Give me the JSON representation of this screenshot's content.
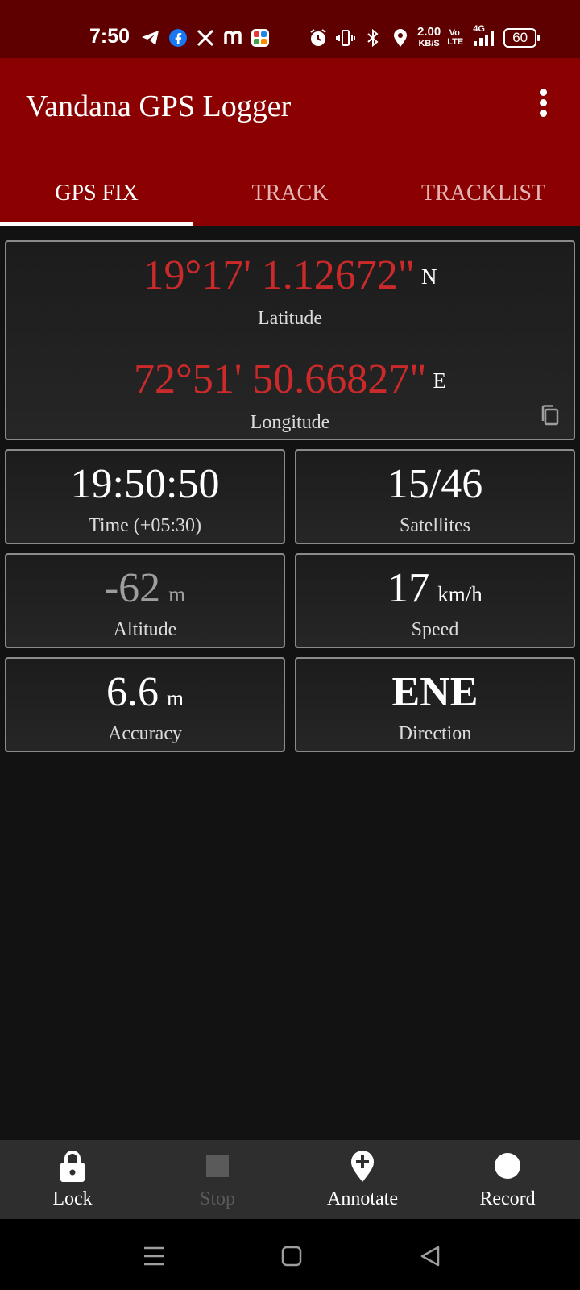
{
  "status_bar": {
    "time": "7:50",
    "net_speed_value": "2.00",
    "net_speed_unit": "KB/S",
    "volte": "Vo LTE",
    "network": "4G",
    "battery": "60"
  },
  "app": {
    "title": "Vandana GPS Logger",
    "tabs": [
      {
        "label": "GPS FIX",
        "active": true
      },
      {
        "label": "TRACK",
        "active": false
      },
      {
        "label": "TRACKLIST",
        "active": false
      }
    ]
  },
  "fix": {
    "latitude": {
      "value": "19°17' 1.12672\"",
      "hemisphere": "N",
      "label": "Latitude"
    },
    "longitude": {
      "value": "72°51' 50.66827\"",
      "hemisphere": "E",
      "label": "Longitude"
    },
    "time": {
      "value": "19:50:50",
      "label": "Time (+05:30)"
    },
    "satellites": {
      "value": "15/46",
      "label": "Satellites"
    },
    "altitude": {
      "value": "-62",
      "unit": "m",
      "label": "Altitude"
    },
    "speed": {
      "value": "17",
      "unit": "km/h",
      "label": "Speed"
    },
    "accuracy": {
      "value": "6.6",
      "unit": "m",
      "label": "Accuracy"
    },
    "direction": {
      "value": "ENE",
      "label": "Direction"
    }
  },
  "bottom_bar": {
    "lock": "Lock",
    "stop": "Stop",
    "annotate": "Annotate",
    "record": "Record"
  },
  "colors": {
    "status_bar": "#5e0000",
    "app_bar": "#8b0000",
    "coordinate": "#cc2a2a",
    "background": "#121212"
  },
  "icons": [
    "telegram-icon",
    "facebook-icon",
    "x-icon",
    "m-icon",
    "apps-icon",
    "alarm-icon",
    "vibrate-icon",
    "bluetooth-icon",
    "location-icon",
    "signal-icon",
    "copy-icon",
    "lock-icon",
    "stop-icon",
    "annotate-icon",
    "record-icon",
    "menu-icon",
    "home-icon",
    "back-icon"
  ]
}
